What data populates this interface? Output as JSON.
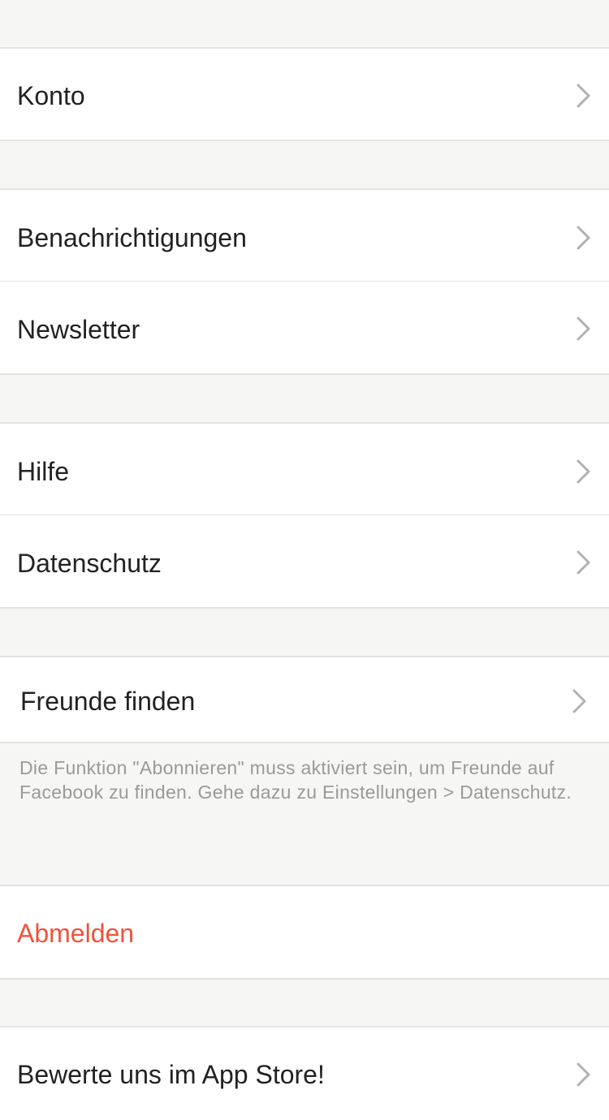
{
  "settings": {
    "account": {
      "label": "Konto",
      "chevron_icon": "chevron-right-icon"
    },
    "notifications": {
      "label": "Benachrichtigungen",
      "chevron_icon": "chevron-right-icon"
    },
    "newsletter": {
      "label": "Newsletter",
      "chevron_icon": "chevron-right-icon"
    },
    "help": {
      "label": "Hilfe",
      "chevron_icon": "chevron-right-icon"
    },
    "privacy": {
      "label": "Datenschutz",
      "chevron_icon": "chevron-right-icon"
    },
    "find_friends": {
      "label": "Freunde finden",
      "chevron_icon": "chevron-right-icon",
      "footnote": "Die Funktion \"Abonnieren\" muss aktiviert sein, um Freunde auf Facebook zu finden. Gehe dazu zu Einstellungen > Datenschutz."
    },
    "logout": {
      "label": "Abmelden",
      "color": "#f0523c"
    },
    "rate_app": {
      "label": "Bewerte uns im App Store!",
      "chevron_icon": "chevron-right-icon"
    }
  },
  "colors": {
    "background": "#f6f6f4",
    "cell": "#ffffff",
    "separator": "#e3e3e1",
    "text": "#222222",
    "footnote": "#9a9a98",
    "chevron": "#b1b1b1",
    "destructive": "#f0523c"
  }
}
